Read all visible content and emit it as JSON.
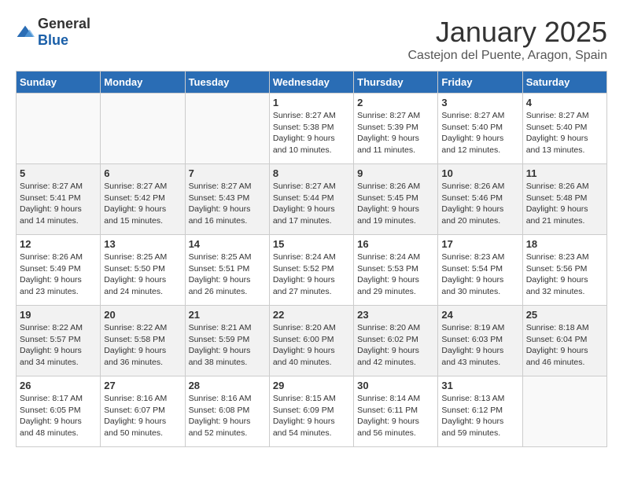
{
  "logo": {
    "general": "General",
    "blue": "Blue"
  },
  "title": "January 2025",
  "location": "Castejon del Puente, Aragon, Spain",
  "headers": [
    "Sunday",
    "Monday",
    "Tuesday",
    "Wednesday",
    "Thursday",
    "Friday",
    "Saturday"
  ],
  "weeks": [
    [
      {
        "day": "",
        "info": ""
      },
      {
        "day": "",
        "info": ""
      },
      {
        "day": "",
        "info": ""
      },
      {
        "day": "1",
        "info": "Sunrise: 8:27 AM\nSunset: 5:38 PM\nDaylight: 9 hours and 10 minutes."
      },
      {
        "day": "2",
        "info": "Sunrise: 8:27 AM\nSunset: 5:39 PM\nDaylight: 9 hours and 11 minutes."
      },
      {
        "day": "3",
        "info": "Sunrise: 8:27 AM\nSunset: 5:40 PM\nDaylight: 9 hours and 12 minutes."
      },
      {
        "day": "4",
        "info": "Sunrise: 8:27 AM\nSunset: 5:40 PM\nDaylight: 9 hours and 13 minutes."
      }
    ],
    [
      {
        "day": "5",
        "info": "Sunrise: 8:27 AM\nSunset: 5:41 PM\nDaylight: 9 hours and 14 minutes."
      },
      {
        "day": "6",
        "info": "Sunrise: 8:27 AM\nSunset: 5:42 PM\nDaylight: 9 hours and 15 minutes."
      },
      {
        "day": "7",
        "info": "Sunrise: 8:27 AM\nSunset: 5:43 PM\nDaylight: 9 hours and 16 minutes."
      },
      {
        "day": "8",
        "info": "Sunrise: 8:27 AM\nSunset: 5:44 PM\nDaylight: 9 hours and 17 minutes."
      },
      {
        "day": "9",
        "info": "Sunrise: 8:26 AM\nSunset: 5:45 PM\nDaylight: 9 hours and 19 minutes."
      },
      {
        "day": "10",
        "info": "Sunrise: 8:26 AM\nSunset: 5:46 PM\nDaylight: 9 hours and 20 minutes."
      },
      {
        "day": "11",
        "info": "Sunrise: 8:26 AM\nSunset: 5:48 PM\nDaylight: 9 hours and 21 minutes."
      }
    ],
    [
      {
        "day": "12",
        "info": "Sunrise: 8:26 AM\nSunset: 5:49 PM\nDaylight: 9 hours and 23 minutes."
      },
      {
        "day": "13",
        "info": "Sunrise: 8:25 AM\nSunset: 5:50 PM\nDaylight: 9 hours and 24 minutes."
      },
      {
        "day": "14",
        "info": "Sunrise: 8:25 AM\nSunset: 5:51 PM\nDaylight: 9 hours and 26 minutes."
      },
      {
        "day": "15",
        "info": "Sunrise: 8:24 AM\nSunset: 5:52 PM\nDaylight: 9 hours and 27 minutes."
      },
      {
        "day": "16",
        "info": "Sunrise: 8:24 AM\nSunset: 5:53 PM\nDaylight: 9 hours and 29 minutes."
      },
      {
        "day": "17",
        "info": "Sunrise: 8:23 AM\nSunset: 5:54 PM\nDaylight: 9 hours and 30 minutes."
      },
      {
        "day": "18",
        "info": "Sunrise: 8:23 AM\nSunset: 5:56 PM\nDaylight: 9 hours and 32 minutes."
      }
    ],
    [
      {
        "day": "19",
        "info": "Sunrise: 8:22 AM\nSunset: 5:57 PM\nDaylight: 9 hours and 34 minutes."
      },
      {
        "day": "20",
        "info": "Sunrise: 8:22 AM\nSunset: 5:58 PM\nDaylight: 9 hours and 36 minutes."
      },
      {
        "day": "21",
        "info": "Sunrise: 8:21 AM\nSunset: 5:59 PM\nDaylight: 9 hours and 38 minutes."
      },
      {
        "day": "22",
        "info": "Sunrise: 8:20 AM\nSunset: 6:00 PM\nDaylight: 9 hours and 40 minutes."
      },
      {
        "day": "23",
        "info": "Sunrise: 8:20 AM\nSunset: 6:02 PM\nDaylight: 9 hours and 42 minutes."
      },
      {
        "day": "24",
        "info": "Sunrise: 8:19 AM\nSunset: 6:03 PM\nDaylight: 9 hours and 43 minutes."
      },
      {
        "day": "25",
        "info": "Sunrise: 8:18 AM\nSunset: 6:04 PM\nDaylight: 9 hours and 46 minutes."
      }
    ],
    [
      {
        "day": "26",
        "info": "Sunrise: 8:17 AM\nSunset: 6:05 PM\nDaylight: 9 hours and 48 minutes."
      },
      {
        "day": "27",
        "info": "Sunrise: 8:16 AM\nSunset: 6:07 PM\nDaylight: 9 hours and 50 minutes."
      },
      {
        "day": "28",
        "info": "Sunrise: 8:16 AM\nSunset: 6:08 PM\nDaylight: 9 hours and 52 minutes."
      },
      {
        "day": "29",
        "info": "Sunrise: 8:15 AM\nSunset: 6:09 PM\nDaylight: 9 hours and 54 minutes."
      },
      {
        "day": "30",
        "info": "Sunrise: 8:14 AM\nSunset: 6:11 PM\nDaylight: 9 hours and 56 minutes."
      },
      {
        "day": "31",
        "info": "Sunrise: 8:13 AM\nSunset: 6:12 PM\nDaylight: 9 hours and 59 minutes."
      },
      {
        "day": "",
        "info": ""
      }
    ]
  ]
}
